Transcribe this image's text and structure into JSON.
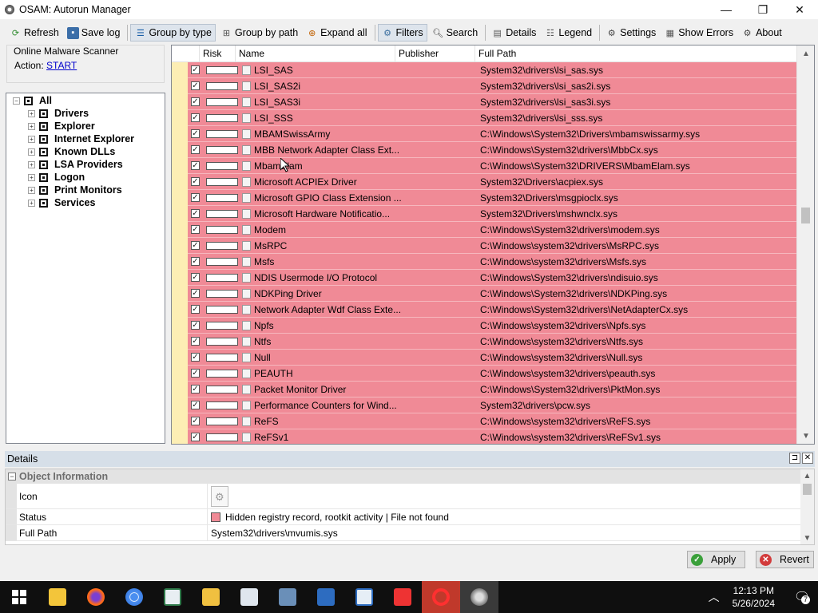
{
  "window": {
    "title": "OSAM: Autorun Manager",
    "minimize": "—",
    "maximize": "❐",
    "close": "✕"
  },
  "toolbar": {
    "refresh": "Refresh",
    "save_log": "Save log",
    "group_by_type": "Group by type",
    "group_by_path": "Group by path",
    "expand_all": "Expand all",
    "filters": "Filters",
    "search": "Search",
    "details": "Details",
    "legend": "Legend",
    "settings": "Settings",
    "show_errors": "Show Errors",
    "about": "About"
  },
  "scanner": {
    "group_title": "Online Malware Scanner",
    "action_label": "Action:",
    "action_link": "START"
  },
  "tree": {
    "root": "All",
    "items": [
      "Drivers",
      "Explorer",
      "Internet Explorer",
      "Known DLLs",
      "LSA Providers",
      "Logon",
      "Print Monitors",
      "Services"
    ]
  },
  "grid": {
    "columns": [
      "",
      "Risk",
      "Name",
      "Publisher",
      "Full Path"
    ],
    "rows": [
      {
        "name": "LSI_SAS",
        "path": "System32\\drivers\\lsi_sas.sys"
      },
      {
        "name": "LSI_SAS2i",
        "path": "System32\\drivers\\lsi_sas2i.sys"
      },
      {
        "name": "LSI_SAS3i",
        "path": "System32\\drivers\\lsi_sas3i.sys"
      },
      {
        "name": "LSI_SSS",
        "path": "System32\\drivers\\lsi_sss.sys"
      },
      {
        "name": "MBAMSwissArmy",
        "path": "C:\\Windows\\System32\\Drivers\\mbamswissarmy.sys"
      },
      {
        "name": "MBB Network Adapter Class Ext...",
        "path": "C:\\Windows\\System32\\drivers\\MbbCx.sys"
      },
      {
        "name": "MbamElam",
        "path": "C:\\Windows\\System32\\DRIVERS\\MbamElam.sys"
      },
      {
        "name": "Microsoft ACPIEx Driver",
        "path": "System32\\Drivers\\acpiex.sys"
      },
      {
        "name": "Microsoft GPIO Class Extension ...",
        "path": "System32\\Drivers\\msgpioclx.sys"
      },
      {
        "name": "Microsoft Hardware Notificatio...",
        "path": "System32\\Drivers\\mshwnclx.sys"
      },
      {
        "name": "Modem",
        "path": "C:\\Windows\\System32\\drivers\\modem.sys"
      },
      {
        "name": "MsRPC",
        "path": "C:\\Windows\\system32\\drivers\\MsRPC.sys"
      },
      {
        "name": "Msfs",
        "path": "C:\\Windows\\system32\\drivers\\Msfs.sys"
      },
      {
        "name": "NDIS Usermode I/O Protocol",
        "path": "C:\\Windows\\System32\\drivers\\ndisuio.sys"
      },
      {
        "name": "NDKPing Driver",
        "path": "C:\\Windows\\System32\\drivers\\NDKPing.sys"
      },
      {
        "name": "Network Adapter Wdf Class Exte...",
        "path": "C:\\Windows\\System32\\drivers\\NetAdapterCx.sys"
      },
      {
        "name": "Npfs",
        "path": "C:\\Windows\\system32\\drivers\\Npfs.sys"
      },
      {
        "name": "Ntfs",
        "path": "C:\\Windows\\system32\\drivers\\Ntfs.sys"
      },
      {
        "name": "Null",
        "path": "C:\\Windows\\system32\\drivers\\Null.sys"
      },
      {
        "name": "PEAUTH",
        "path": "C:\\Windows\\system32\\drivers\\peauth.sys"
      },
      {
        "name": "Packet Monitor Driver",
        "path": "C:\\Windows\\System32\\drivers\\PktMon.sys"
      },
      {
        "name": "Performance Counters for Wind...",
        "path": "System32\\drivers\\pcw.sys"
      },
      {
        "name": "ReFS",
        "path": "C:\\Windows\\system32\\drivers\\ReFS.sys"
      },
      {
        "name": "ReFSv1",
        "path": "C:\\Windows\\system32\\drivers\\ReFSv1.sys"
      }
    ]
  },
  "details": {
    "title": "Details",
    "pin": "⊐",
    "close": "✕",
    "category": "Object Information",
    "icon_label": "Icon",
    "status_label": "Status",
    "status_value": "Hidden registry record, rootkit activity | File not found",
    "fullpath_label": "Full Path",
    "fullpath_value": "System32\\drivers\\mvumis.sys"
  },
  "buttons": {
    "apply": "Apply",
    "revert": "Revert"
  },
  "taskbar": {
    "time": "12:13 PM",
    "date": "5/26/2024",
    "notification_count": "7"
  },
  "colors": {
    "row_highlight": "#f08a96",
    "gutter": "#fdeeb4",
    "accent_link": "#0000cc"
  }
}
